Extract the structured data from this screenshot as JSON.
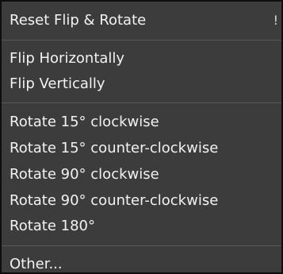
{
  "menu": {
    "items": [
      {
        "label": "Reset Flip & Rotate",
        "shortcut": "!"
      },
      {
        "label": "Flip Horizontally"
      },
      {
        "label": "Flip Vertically"
      },
      {
        "label": "Rotate 15° clockwise"
      },
      {
        "label": "Rotate 15° counter-clockwise"
      },
      {
        "label": "Rotate 90° clockwise"
      },
      {
        "label": "Rotate 90° counter-clockwise"
      },
      {
        "label": "Rotate 180°"
      },
      {
        "label": "Other..."
      }
    ]
  },
  "colors": {
    "menu_background": "#3c3c3c",
    "text": "#f2f2f2",
    "separator": "#575757",
    "border": "#0e0e0e"
  }
}
